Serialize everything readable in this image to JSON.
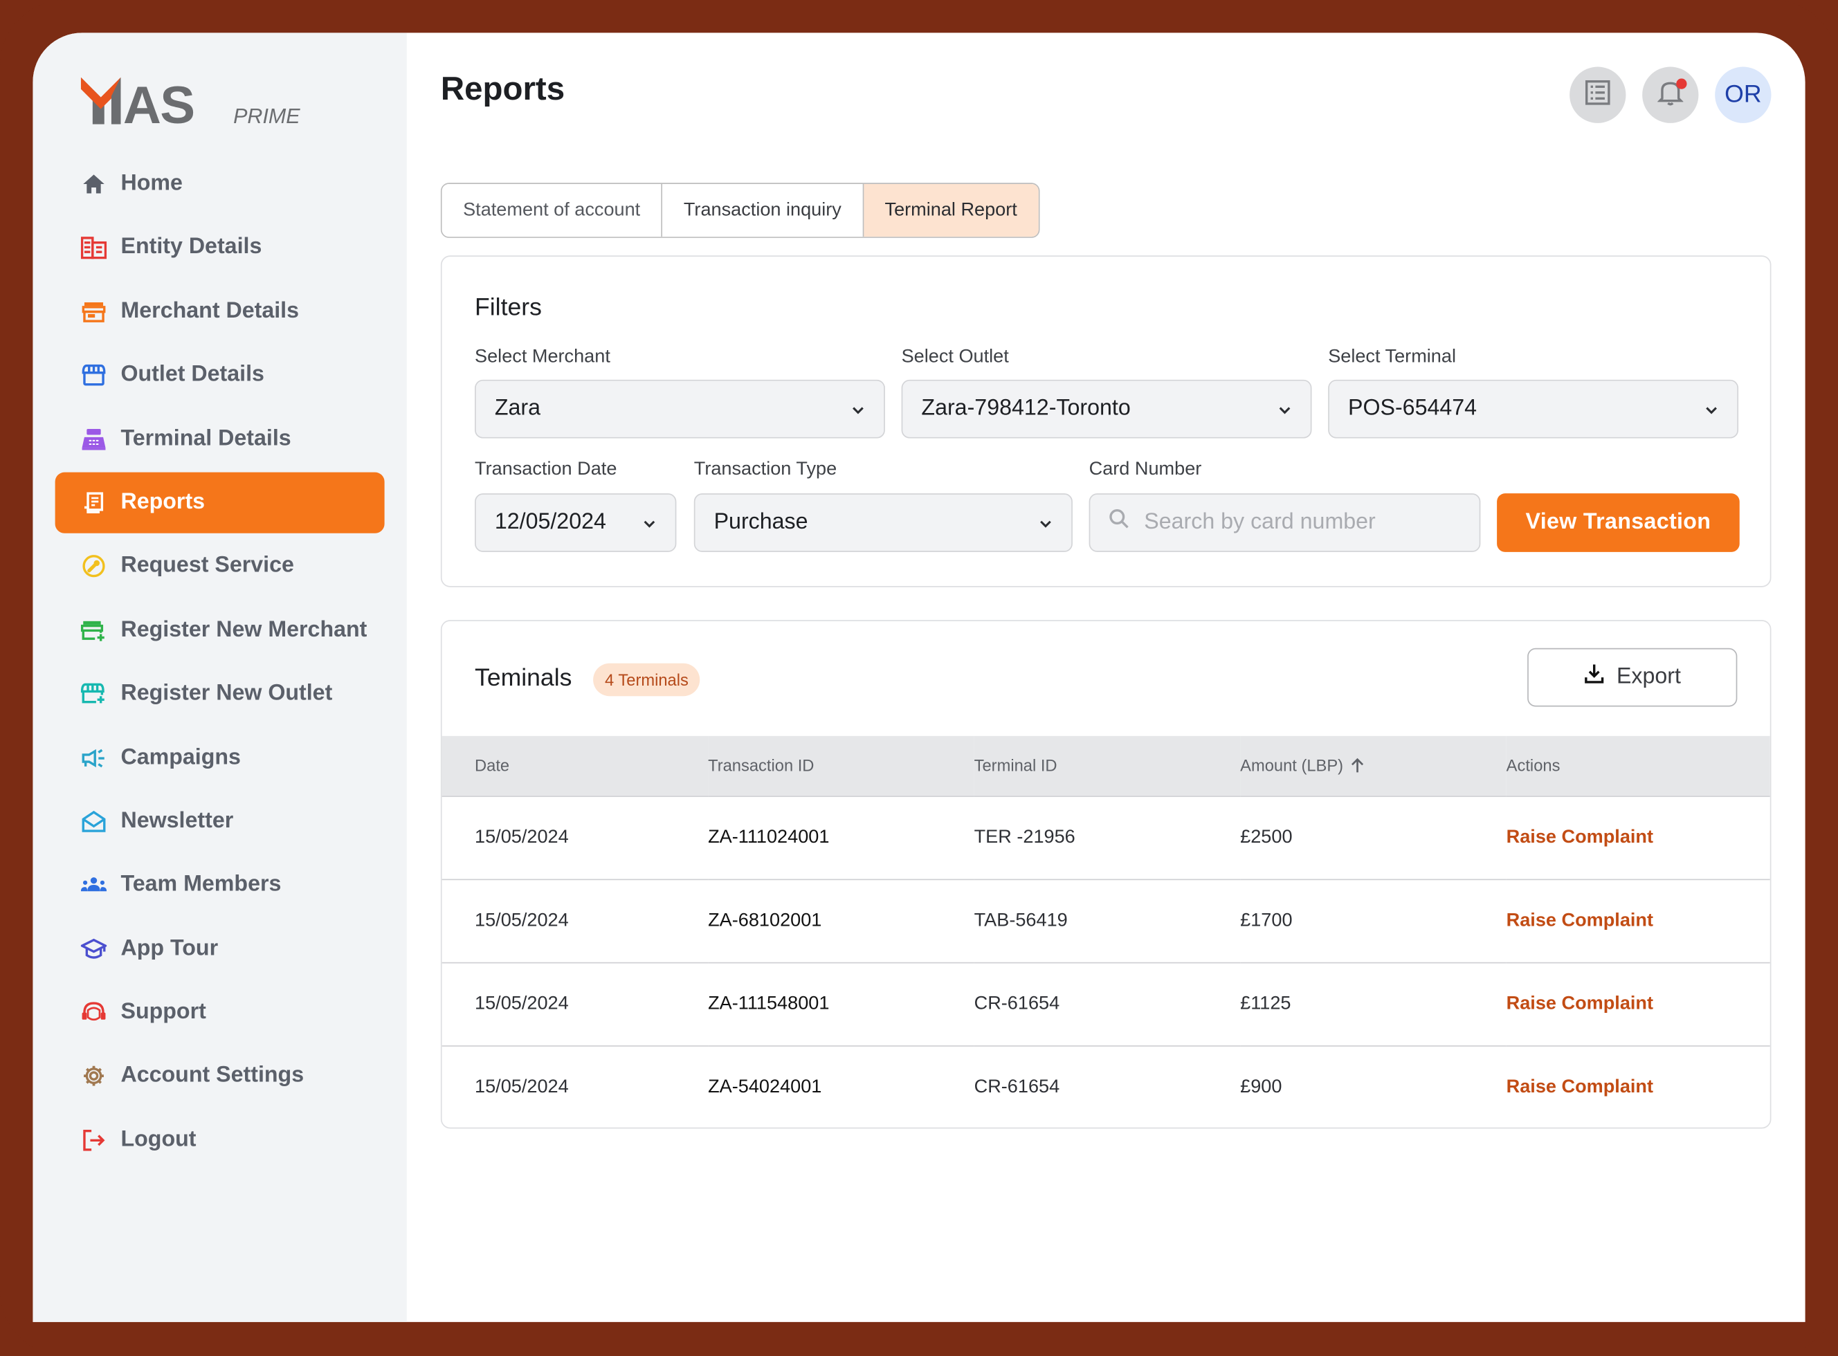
{
  "brand": {
    "name": "MAS",
    "sub": "PRIME",
    "accent": "#f5761a",
    "frame": "#7b2c14"
  },
  "sidebar": {
    "items": [
      {
        "label": "Home",
        "icon": "home-icon",
        "color": "#5b606a"
      },
      {
        "label": "Entity Details",
        "icon": "building-icon",
        "color": "#e53935"
      },
      {
        "label": "Merchant Details",
        "icon": "store-icon",
        "color": "#f5761a"
      },
      {
        "label": "Outlet Details",
        "icon": "storefront-icon",
        "color": "#2f6fe0"
      },
      {
        "label": "Terminal Details",
        "icon": "cash-register-icon",
        "color": "#9b59e6"
      },
      {
        "label": "Reports",
        "icon": "receipt-icon",
        "color": "#ffffff",
        "active": true
      },
      {
        "label": "Request Service",
        "icon": "wrench-icon",
        "color": "#f2c01e"
      },
      {
        "label": "Register New Merchant",
        "icon": "store-add-icon",
        "color": "#2fb34a"
      },
      {
        "label": "Register New Outlet",
        "icon": "storefront-add-icon",
        "color": "#17b8b0"
      },
      {
        "label": "Campaigns",
        "icon": "megaphone-icon",
        "color": "#2aa3c9"
      },
      {
        "label": "Newsletter",
        "icon": "mail-open-icon",
        "color": "#2aa3d9"
      },
      {
        "label": "Team Members",
        "icon": "team-icon",
        "color": "#2f6fe0"
      },
      {
        "label": "App Tour",
        "icon": "graduation-cap-icon",
        "color": "#4b4fcf"
      },
      {
        "label": "Support",
        "icon": "headset-icon",
        "color": "#e53935"
      },
      {
        "label": "Account Settings",
        "icon": "gear-icon",
        "color": "#a07850"
      },
      {
        "label": "Logout",
        "icon": "logout-icon",
        "color": "#e53935"
      }
    ]
  },
  "header": {
    "title": "Reports",
    "avatar_initials": "OR",
    "has_notification": true
  },
  "tabs": [
    {
      "label": "Statement of account"
    },
    {
      "label": "Transaction inquiry"
    },
    {
      "label": "Terminal Report",
      "active": true
    }
  ],
  "filters": {
    "title": "Filters",
    "merchant": {
      "label": "Select Merchant",
      "value": "Zara"
    },
    "outlet": {
      "label": "Select Outlet",
      "value": "Zara-798412-Toronto"
    },
    "terminal": {
      "label": "Select Terminal",
      "value": "POS-654474"
    },
    "date": {
      "label": "Transaction Date",
      "value": "12/05/2024"
    },
    "type": {
      "label": "Transaction Type",
      "value": "Purchase"
    },
    "card": {
      "label": "Card Number",
      "placeholder": "Search by card number",
      "value": ""
    },
    "submit_label": "View  Transaction"
  },
  "terminals": {
    "title": "Teminals",
    "badge": "4 Terminals",
    "export_label": "Export",
    "columns": [
      "Date",
      "Transaction ID",
      "Terminal ID",
      "Amount  (LBP)",
      "Actions"
    ],
    "rows": [
      {
        "date": "15/05/2024",
        "txn_id": "ZA-111024001",
        "terminal_id": "TER -21956",
        "amount": "£2500",
        "action": "Raise Complaint"
      },
      {
        "date": "15/05/2024",
        "txn_id": "ZA-68102001",
        "terminal_id": "TAB-56419",
        "amount": "£1700",
        "action": "Raise Complaint"
      },
      {
        "date": "15/05/2024",
        "txn_id": "ZA-111548001",
        "terminal_id": "CR-61654",
        "amount": "£1125",
        "action": "Raise Complaint"
      },
      {
        "date": "15/05/2024",
        "txn_id": "ZA-54024001",
        "terminal_id": "CR-61654",
        "amount": "£900",
        "action": "Raise Complaint"
      }
    ]
  }
}
